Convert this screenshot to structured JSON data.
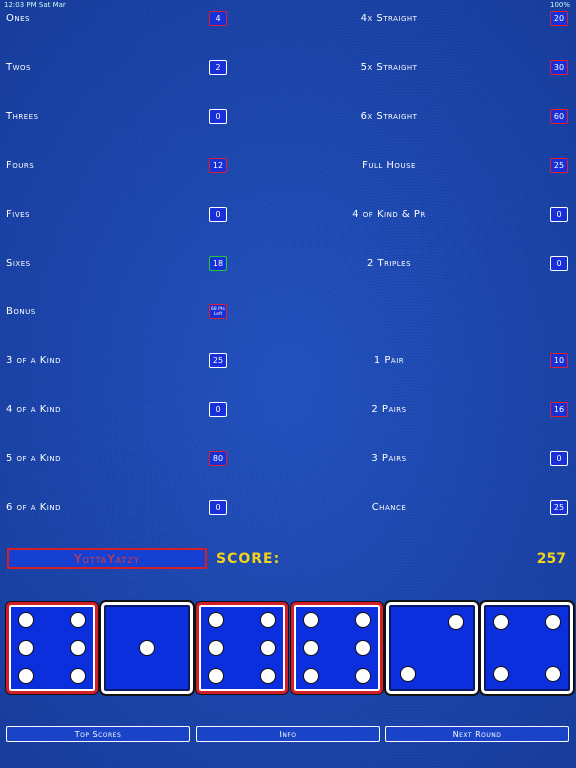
{
  "status_bar": {
    "time": "12:03 PM  Sat Mar",
    "battery": "100%"
  },
  "left_rows": [
    {
      "label": "Ones",
      "value": "4",
      "border": "red"
    },
    {
      "label": "Twos",
      "value": "2",
      "border": "white"
    },
    {
      "label": "Threes",
      "value": "0",
      "border": "white"
    },
    {
      "label": "Fours",
      "value": "12",
      "border": "red"
    },
    {
      "label": "Fives",
      "value": "0",
      "border": "white"
    },
    {
      "label": "Sixes",
      "value": "18",
      "border": "green"
    },
    {
      "label": "Bonus",
      "value": "68 Pts Left",
      "border": "red"
    },
    {
      "label": "3 of a Kind",
      "value": "25",
      "border": "white"
    },
    {
      "label": "4 of a Kind",
      "value": "0",
      "border": "white"
    },
    {
      "label": "5 of a Kind",
      "value": "80",
      "border": "red"
    },
    {
      "label": "6 of a Kind",
      "value": "0",
      "border": "white"
    }
  ],
  "right_rows": [
    {
      "label": "4x Straight",
      "value": "20",
      "border": "red"
    },
    {
      "label": "5x Straight",
      "value": "30",
      "border": "red"
    },
    {
      "label": "6x Straight",
      "value": "60",
      "border": "red"
    },
    {
      "label": "Full House",
      "value": "25",
      "border": "red"
    },
    {
      "label": "4 of Kind & Pr",
      "value": "0",
      "border": "white"
    },
    {
      "label": "2 Triples",
      "value": "0",
      "border": "white"
    },
    {
      "label": "1 Pair",
      "value": "10",
      "border": "red"
    },
    {
      "label": "2 Pairs",
      "value": "16",
      "border": "red"
    },
    {
      "label": "3 Pairs",
      "value": "0",
      "border": "white"
    },
    {
      "label": "Chance",
      "value": "25",
      "border": "white"
    }
  ],
  "game": {
    "title": "YottaYatzy",
    "score_label": "SCORE:",
    "score": "257"
  },
  "dice": [
    {
      "value": 6,
      "held": true
    },
    {
      "value": 1,
      "held": false
    },
    {
      "value": 6,
      "held": true
    },
    {
      "value": 6,
      "held": true
    },
    {
      "value": 2,
      "held": false
    },
    {
      "value": 4,
      "held": false
    }
  ],
  "buttons": {
    "top_scores": "Top Scores",
    "info": "Info",
    "next_round": "Next Round"
  },
  "colors": {
    "accent_red": "#d41f28",
    "score_yellow": "#f4d21a",
    "die_blue": "#0b2fdc"
  }
}
